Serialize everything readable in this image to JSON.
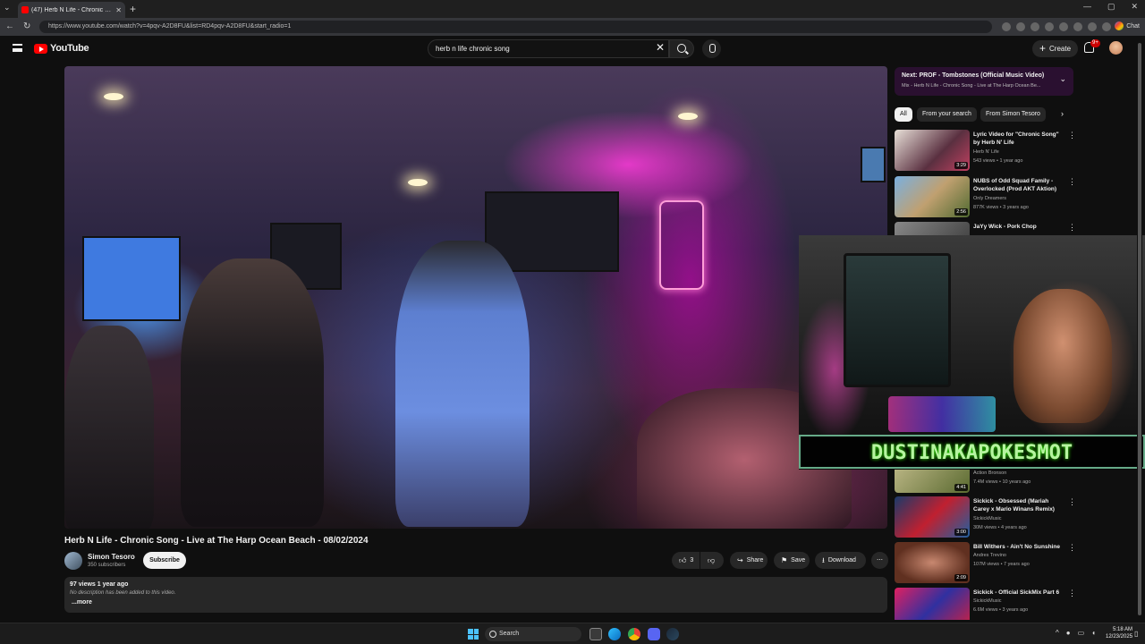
{
  "browser": {
    "tab_title": "(47) Herb N Life - Chronic Sor",
    "tab_close": "✕",
    "new_tab": "+",
    "url": "https://www.youtube.com/watch?v=4pqv-A2D8FU&list=RD4pqv-A2D8FU&start_radio=1",
    "chat_label": "Chat",
    "window_controls": [
      "—",
      "▢",
      "✕"
    ]
  },
  "header": {
    "logo_text": "YouTube",
    "search_value": "herb n life chronic song",
    "clear_icon": "✕",
    "create_label": "Create",
    "notification_count": "9+"
  },
  "video": {
    "title": "Herb N Life - Chronic Song - Live at The Harp Ocean Beach - 08/02/2024",
    "channel_name": "Simon Tesoro",
    "channel_subs": "350 subscribers",
    "subscribe_label": "Subscribe",
    "likes": "3",
    "share_label": "Share",
    "save_label": "Save",
    "download_label": "Download",
    "more_icon": "⋯"
  },
  "description": {
    "meta": "97 views  1 year ago",
    "text": "No description has been added to this video.",
    "more": "...more"
  },
  "next_up": {
    "title": "Next: PROF - Tombstones (Official Music Video)",
    "subtitle": "Mix - Herb N Life - Chronic Song - Live at The Harp Ocean Be..."
  },
  "chips": [
    "All",
    "From your search",
    "From Simon Tesoro"
  ],
  "recommendations": [
    {
      "title": "Lyric Video for \"Chronic Song\" by Herb N' Life",
      "channel": "Herb N' Life",
      "meta": "543 views • 1 year ago",
      "duration": "3:29"
    },
    {
      "title": "NUBS of Odd Squad Family - Overlocked  (Prod AKT Aktion)",
      "channel": "Only Dreamers",
      "meta": "877K views • 3 years ago",
      "duration": "2:56"
    },
    {
      "title": "JaYy Wick - Pork Chop",
      "channel": "",
      "meta": "",
      "duration": ""
    },
    {
      "title": "",
      "channel": "Action Bronson",
      "meta": "7.4M views • 10 years ago",
      "duration": "4:41"
    },
    {
      "title": "Sickick - Obsessed (Mariah Carey x Mario Winans Remix)",
      "channel": "SickickMusic",
      "meta": "30M views • 4 years ago",
      "duration": "3:00"
    },
    {
      "title": "Bill Withers - Ain't No Sunshine",
      "channel": "Andres Trevino",
      "meta": "107M views • 7 years ago",
      "duration": "2:09"
    },
    {
      "title": "Sickick - Official SickMix Part 6",
      "channel": "SickickMusic",
      "meta": "6.6M views • 3 years ago",
      "duration": ""
    }
  ],
  "overlay": {
    "banner": "DUSTINAKAPOKESMOT"
  },
  "taskbar": {
    "search_label": "Search",
    "time": "5:18 AM",
    "date": "12/23/2025"
  }
}
